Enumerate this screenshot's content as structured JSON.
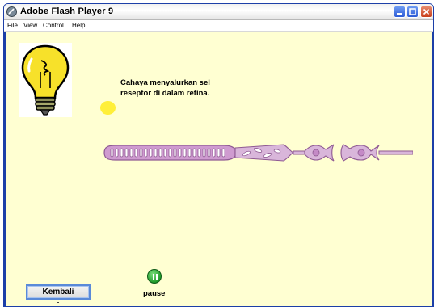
{
  "window": {
    "title": "Adobe Flash Player 9",
    "controls": {
      "minimize": "minimize-icon",
      "maximize": "maximize-icon",
      "close": "close-icon"
    }
  },
  "menu": {
    "items": [
      "File",
      "View",
      "Control",
      "Help"
    ]
  },
  "stage": {
    "background": "#ffffd2",
    "caption_line1": "Cahaya menyalurkan sel",
    "caption_line2": "reseptor di dalam retina.",
    "bulb_icon": "lightbulb-icon",
    "light_dot_color": "#ffef3a",
    "pause_label": "pause",
    "back_button": "Kembali"
  }
}
